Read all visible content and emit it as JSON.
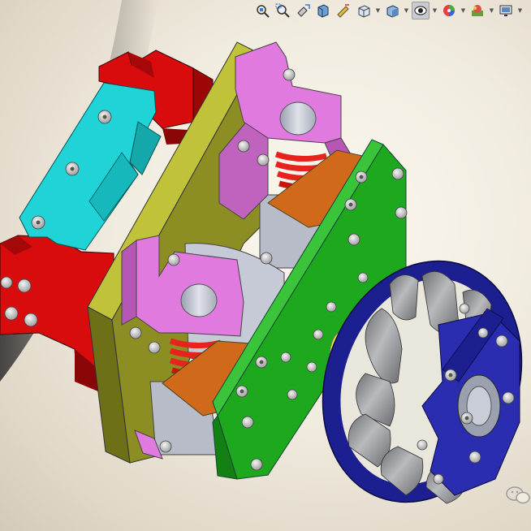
{
  "colors": {
    "background": "#f1ece0",
    "red_frame": "#d80c0c",
    "cyan_bracket": "#1fd3d6",
    "olive_plate": "#8c8e24",
    "pink_block": "#e07adf",
    "orange_plate": "#d06a1a",
    "green_plate": "#1ea81e",
    "spring": "#e8221c",
    "steel": "#c0c4d0",
    "yellow_hub": "#f2ee30",
    "wheel_blue": "#1c1f8f",
    "roller_gray": "#8e8f93",
    "toolbar_active": "#c9cbd0"
  },
  "toolbar": {
    "buttons": [
      {
        "icon": "zoom-to-fit-icon"
      },
      {
        "icon": "zoom-to-area-icon"
      },
      {
        "icon": "previous-view-icon"
      },
      {
        "icon": "section-view-icon"
      },
      {
        "icon": "dynamic-annotation-icon"
      },
      {
        "icon": "view-orientation-icon",
        "dropdown": true
      },
      {
        "icon": "display-style-icon",
        "dropdown": true
      },
      {
        "icon": "hide-show-items-icon",
        "dropdown": true,
        "active": true
      },
      {
        "icon": "edit-appearance-icon",
        "dropdown": true
      },
      {
        "icon": "apply-scene-icon",
        "dropdown": true
      },
      {
        "icon": "view-settings-icon",
        "dropdown": true
      }
    ]
  },
  "watermark": {
    "icon": "wechat-logo-icon"
  }
}
